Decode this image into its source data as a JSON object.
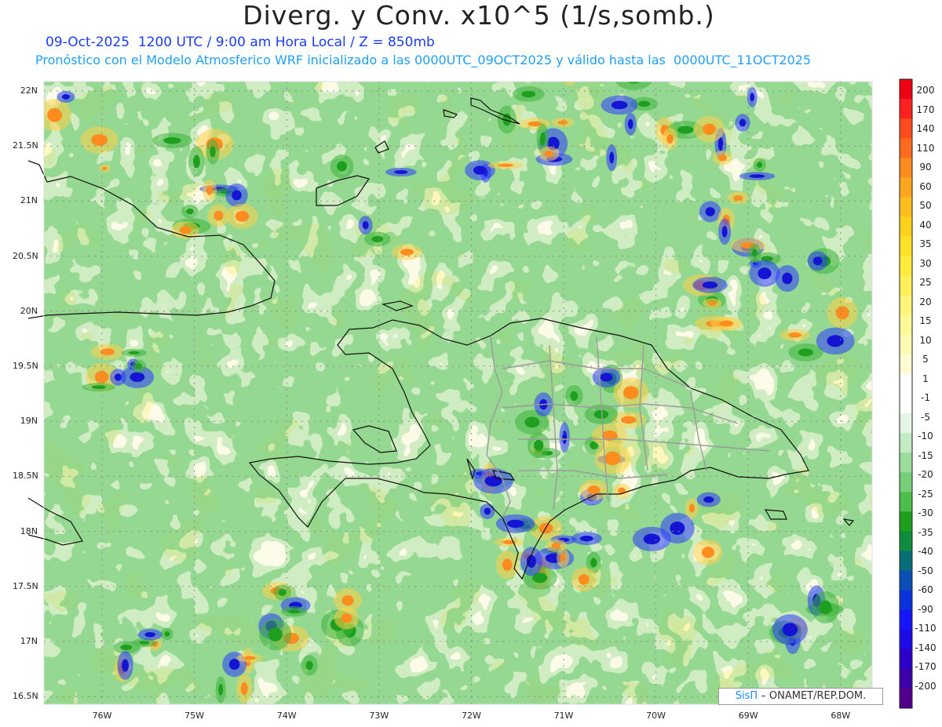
{
  "header": {
    "title": "Diverg. y Conv. x10^5 (1/s,somb.)",
    "line1": "09-Oct-2025  1200 UTC / 9:00 am Hora Local / Z = 850mb",
    "line2": "Pronóstico con el Modelo Atmosferico WRF inicializado a las 0000UTC_09OCT2025 y válido hasta las  0000UTC_11OCT2025"
  },
  "axes": {
    "lat_labels": [
      "22N",
      "21.5N",
      "21N",
      "20.5N",
      "20N",
      "19.5N",
      "19N",
      "18.5N",
      "18N",
      "17.5N",
      "17N",
      "16.5N"
    ],
    "lon_labels": [
      "76W",
      "75W",
      "74W",
      "73W",
      "72W",
      "71W",
      "70W",
      "69W",
      "68W"
    ],
    "lat_range": [
      16.5,
      22.0
    ],
    "lon_range": [
      -76.6,
      -67.5
    ]
  },
  "colorbar": {
    "labels": [
      "200",
      "170",
      "140",
      "110",
      "90",
      "60",
      "50",
      "40",
      "35",
      "30",
      "25",
      "20",
      "15",
      "10",
      "5",
      "1",
      "-1",
      "-5",
      "-10",
      "-15",
      "-20",
      "-25",
      "-30",
      "-35",
      "-40",
      "-50",
      "-60",
      "-90",
      "-110",
      "-140",
      "-170",
      "-200"
    ],
    "colors": [
      "#f00014",
      "#ff2020",
      "#ff4a1e",
      "#ff6a1e",
      "#ff8c1e",
      "#ffa51e",
      "#ffbe1e",
      "#ffd21e",
      "#ffe128",
      "#ffeb3c",
      "#fff05a",
      "#fff578",
      "#fff896",
      "#fffab4",
      "#fffcd2",
      "#ffffff",
      "#ffffff",
      "#e6f5e6",
      "#c3ebc3",
      "#9bdc9b",
      "#78cd78",
      "#4bbe4b",
      "#1ea01e",
      "#0f8c3c",
      "#0a6e78",
      "#0a50b4",
      "#0a32dc",
      "#1414ff",
      "#1e0ae6",
      "#2d00c8",
      "#3c00aa",
      "#50008c"
    ]
  },
  "credit": {
    "brand": "SisΠ",
    "text": "– ONAMET/REP.DOM."
  }
}
